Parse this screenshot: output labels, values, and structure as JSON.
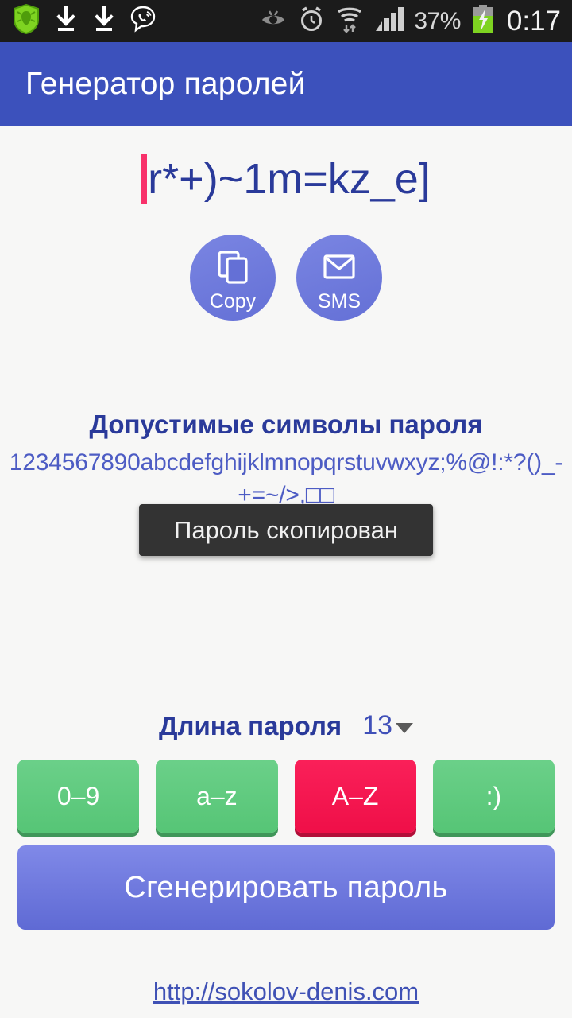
{
  "statusbar": {
    "left_icons": [
      {
        "name": "dr-web-shield-icon",
        "label": "Dr.Web"
      },
      {
        "name": "download-icon",
        "label": "Download"
      },
      {
        "name": "download-icon",
        "label": "Download"
      },
      {
        "name": "viber-icon",
        "label": "Viber"
      }
    ],
    "right_icons": [
      {
        "name": "eye-off-icon",
        "label": "Eye"
      },
      {
        "name": "alarm-clock-icon",
        "label": "Alarm"
      },
      {
        "name": "wifi-icon",
        "label": "Wi-Fi"
      },
      {
        "name": "signal-bars-icon",
        "label": "Signal"
      }
    ],
    "battery_percent": "37%",
    "clock": "0:17"
  },
  "appbar": {
    "title": "Генератор паролей",
    "background": "#3c51bc"
  },
  "password": {
    "value": "r*+)~1m=kz_e]",
    "caret_color": "#f8316a",
    "text_color": "#2a3a9a"
  },
  "actions": [
    {
      "name": "copy-button",
      "label": "Copy",
      "icon": "copy-icon"
    },
    {
      "name": "sms-button",
      "label": "SMS",
      "icon": "envelope-icon"
    }
  ],
  "charset": {
    "title": "Допустимые символы пароля",
    "characters": "1234567890abcdefghijklmnopqrstuvwxyz;%@!:*?()_-+=~/>,□□"
  },
  "toast": {
    "message": "Пароль скопирован",
    "background": "#333333"
  },
  "length": {
    "label": "Длина пароля",
    "value": "13"
  },
  "toggles": [
    {
      "name": "toggle-digits",
      "label": "0–9",
      "state": "on",
      "color": "#56c576"
    },
    {
      "name": "toggle-lowercase",
      "label": "a–z",
      "state": "on",
      "color": "#56c576"
    },
    {
      "name": "toggle-uppercase",
      "label": "A–Z",
      "state": "off",
      "color": "#ef0f48"
    },
    {
      "name": "toggle-symbols",
      "label": ":)",
      "state": "on",
      "color": "#56c576"
    }
  ],
  "generate": {
    "label": "Сгенерировать пароль"
  },
  "footer": {
    "link_text": "http://sokolov-denis.com"
  }
}
